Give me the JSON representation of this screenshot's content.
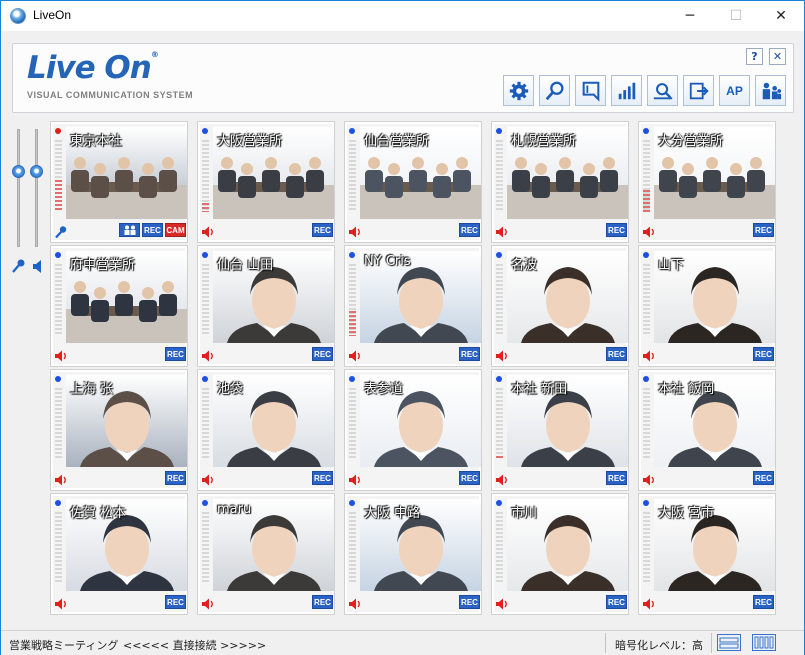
{
  "window": {
    "title": "LiveOn",
    "min": "─",
    "max": "☐",
    "close": "✕"
  },
  "header": {
    "logo": "Live On",
    "reg": "®",
    "tagline": "VISUAL COMMUNICATION SYSTEM",
    "help": "?",
    "close": "✕",
    "tools": [
      "gear-icon",
      "search-icon",
      "bookmark-icon",
      "level-bars-icon",
      "zoom-list-icon",
      "share-icon",
      "AP",
      "users-icon"
    ],
    "ap_label": "AP"
  },
  "colors": {
    "accent": "#2565b8",
    "badge_blue": "#2b63c5",
    "badge_red": "#d92a2a",
    "dot_blue": "#1d4fe0",
    "dot_red": "#e01c1c",
    "mic": "#1e63c8",
    "speaker": "#e02020"
  },
  "participants": [
    {
      "name": "東京本社",
      "dot": "red",
      "audio": "mic",
      "badges": [
        "users",
        "REC",
        "CAM"
      ],
      "level": 0.45
    },
    {
      "name": "大阪営業所",
      "dot": "blue",
      "audio": "speaker",
      "badges": [
        "REC"
      ],
      "level": 0.12
    },
    {
      "name": "仙台営業所",
      "dot": "blue",
      "audio": "speaker",
      "badges": [
        "REC"
      ],
      "level": 0
    },
    {
      "name": "札幌営業所",
      "dot": "blue",
      "audio": "speaker",
      "badges": [
        "REC"
      ],
      "level": 0
    },
    {
      "name": "大分営業所",
      "dot": "blue",
      "audio": "speaker",
      "badges": [
        "REC"
      ],
      "level": 0.3
    },
    {
      "name": "府中営業所",
      "dot": "blue",
      "audio": "speaker",
      "badges": [
        "REC"
      ],
      "level": 0
    },
    {
      "name": "仙台 山田",
      "dot": "blue",
      "audio": "speaker",
      "badges": [
        "REC"
      ],
      "level": 0
    },
    {
      "name": "NY Cris",
      "dot": "blue",
      "audio": "speaker",
      "badges": [
        "REC"
      ],
      "level": 0.35
    },
    {
      "name": "名波",
      "dot": "blue",
      "audio": "speaker",
      "badges": [
        "REC"
      ],
      "level": 0
    },
    {
      "name": "山下",
      "dot": "blue",
      "audio": "speaker",
      "badges": [
        "REC"
      ],
      "level": 0
    },
    {
      "name": "上海 张",
      "dot": "blue",
      "audio": "speaker",
      "badges": [
        "REC"
      ],
      "level": 0
    },
    {
      "name": "池袋",
      "dot": "blue",
      "audio": "speaker",
      "badges": [
        "REC"
      ],
      "level": 0
    },
    {
      "name": "表参道",
      "dot": "blue",
      "audio": "speaker",
      "badges": [
        "REC"
      ],
      "level": 0
    },
    {
      "name": "本社 新田",
      "dot": "blue",
      "audio": "speaker",
      "badges": [
        "REC"
      ],
      "level": 0.05
    },
    {
      "name": "本社 飯岡",
      "dot": "blue",
      "audio": "speaker",
      "badges": [
        "REC"
      ],
      "level": 0
    },
    {
      "name": "佐賀 松本",
      "dot": "blue",
      "audio": "speaker",
      "badges": [
        "REC"
      ],
      "level": 0
    },
    {
      "name": "maru",
      "dot": "blue",
      "audio": "speaker",
      "badges": [
        "REC"
      ],
      "level": 0
    },
    {
      "name": "大阪 中路",
      "dot": "blue",
      "audio": "speaker",
      "badges": [
        "REC"
      ],
      "level": 0
    },
    {
      "name": "市川",
      "dot": "blue",
      "audio": "speaker",
      "badges": [
        "REC"
      ],
      "level": 0
    },
    {
      "name": "大阪 宮市",
      "dot": "blue",
      "audio": "speaker",
      "badges": [
        "REC"
      ],
      "level": 0
    }
  ],
  "status": {
    "meeting": "営業戦略ミーティング",
    "connection": "<<<<< 直接接続 >>>>>",
    "encryption": "暗号化レベル：高"
  }
}
